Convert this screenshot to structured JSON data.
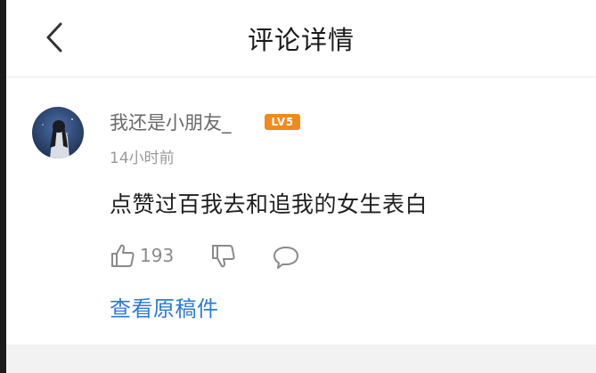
{
  "header": {
    "title": "评论详情",
    "back_icon": "chevron-left-icon"
  },
  "comment": {
    "avatar_icon": "avatar",
    "username": "我还是小朋友_",
    "level_badge": "LV5",
    "level_color": "#f08a1e",
    "time": "14小时前",
    "text": "点赞过百我去和追我的女生表白",
    "likes": "193",
    "view_original": "查看原稿件",
    "link_color": "#2c7ad6"
  }
}
